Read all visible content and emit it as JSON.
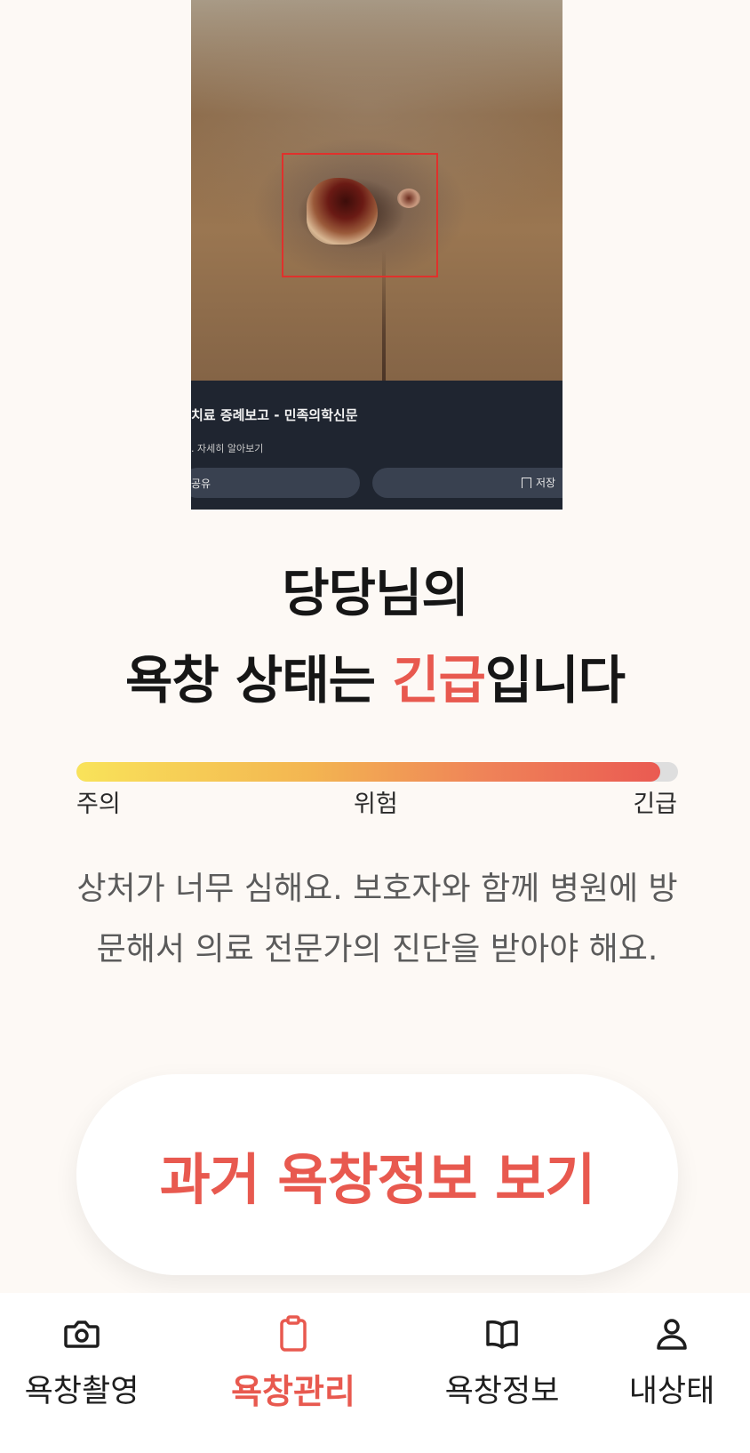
{
  "photo": {
    "caption_title": "치료 증례보고 - 민족의학신문",
    "caption_sub": ". 자세히 알아보기",
    "share_label": "공유",
    "save_label": "저장"
  },
  "result": {
    "line1": "당당님의",
    "line2_prefix": "욕창 상태는 ",
    "line2_status": "긴급",
    "line2_suffix": "입니다"
  },
  "severity": {
    "labels": [
      "주의",
      "위험",
      "긴급"
    ],
    "level_fraction": 0.97,
    "colors": {
      "start": "#f9e35a",
      "end": "#ea5a52",
      "track": "#dedede"
    }
  },
  "description": "상처가 너무 심해요. 보호자와 함께 병원에 방문해서 의료 전문가의 진단을 받아야 해요.",
  "history_button": {
    "label": "과거 욕창정보 보기"
  },
  "nav": {
    "items": [
      {
        "label": "욕창촬영",
        "icon": "camera-icon",
        "active": false
      },
      {
        "label": "욕창관리",
        "icon": "clipboard-icon",
        "active": true
      },
      {
        "label": "욕창정보",
        "icon": "book-icon",
        "active": false
      },
      {
        "label": "내상태",
        "icon": "user-icon",
        "active": false
      }
    ]
  },
  "theme": {
    "accent": "#e8594f",
    "background": "#fdf9f5"
  }
}
